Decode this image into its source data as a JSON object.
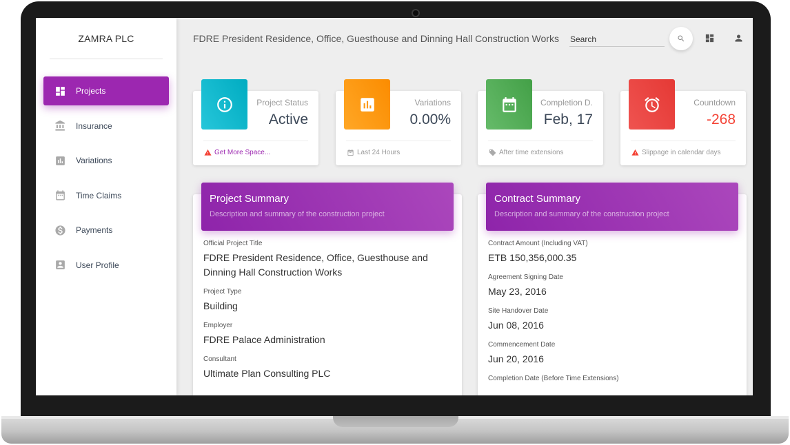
{
  "brand": "ZAMRA PLC",
  "sidebar": {
    "items": [
      {
        "label": "Projects",
        "icon": "dashboard-icon"
      },
      {
        "label": "Insurance",
        "icon": "bank-icon"
      },
      {
        "label": "Variations",
        "icon": "bar-chart-icon"
      },
      {
        "label": "Time Claims",
        "icon": "calendar-icon"
      },
      {
        "label": "Payments",
        "icon": "dollar-circle-icon"
      },
      {
        "label": "User Profile",
        "icon": "account-box-icon"
      }
    ],
    "active_item": "Projects"
  },
  "header": {
    "title": "FDRE President Residence, Office, Guesthouse and Dinning Hall Construction Works",
    "search_placeholder": "Search"
  },
  "stats": [
    {
      "label": "Project Status",
      "value": "Active",
      "footer": "Get More Space...",
      "icon": "info-icon",
      "footer_icon": "warning-icon",
      "color": "#26c6da"
    },
    {
      "label": "Variations",
      "value": "0.00%",
      "footer": "Last 24 Hours",
      "icon": "bar-chart-icon",
      "footer_icon": "calendar-icon",
      "color": "#ff9800"
    },
    {
      "label": "Completion D.",
      "value": "Feb, 17",
      "footer": "After time extensions",
      "icon": "calendar-icon",
      "footer_icon": "tag-icon",
      "color": "#4caf50"
    },
    {
      "label": "Countdown",
      "value": "-268",
      "footer": "Slippage in calendar days",
      "icon": "alarm-icon",
      "footer_icon": "warning-icon",
      "color": "#f44336",
      "value_color": "#f44336"
    }
  ],
  "project_summary": {
    "title": "Project Summary",
    "subtitle": "Description and summary of the construction project",
    "fields": [
      {
        "label": "Official Project Title",
        "value": "FDRE President Residence, Office, Guesthouse and Dinning Hall Construction Works"
      },
      {
        "label": "Project Type",
        "value": "Building"
      },
      {
        "label": "Employer",
        "value": "FDRE Palace Administration"
      },
      {
        "label": "Consultant",
        "value": "Ultimate Plan Consulting PLC"
      }
    ]
  },
  "contract_summary": {
    "title": "Contract Summary",
    "subtitle": "Description and summary of the construction project",
    "fields": [
      {
        "label": "Contract Amount (Including VAT)",
        "value": "ETB 150,356,000.35"
      },
      {
        "label": "Agreement Signing Date",
        "value": "May 23, 2016"
      },
      {
        "label": "Site Handover Date",
        "value": "Jun 08, 2016"
      },
      {
        "label": "Commencement Date",
        "value": "Jun 20, 2016"
      },
      {
        "label": "Completion Date (Before Time Extensions)",
        "value": ""
      }
    ]
  },
  "colors": {
    "accent": "#9c27b0",
    "cyan": "#26c6da",
    "orange": "#ff9800",
    "green": "#4caf50",
    "red": "#f44336"
  }
}
